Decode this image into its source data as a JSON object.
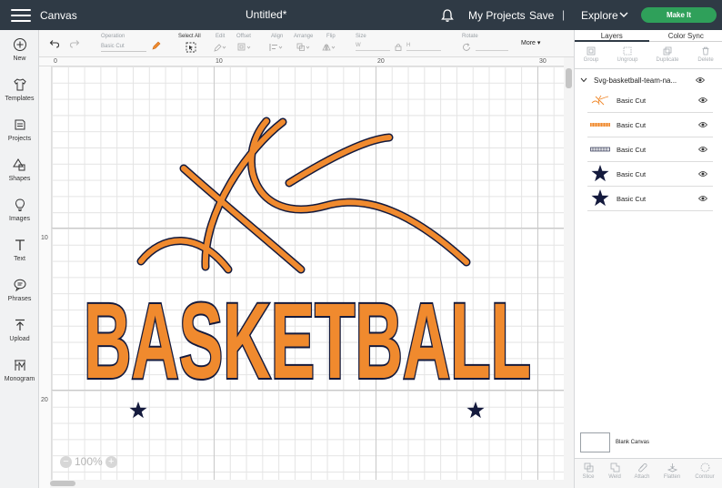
{
  "topbar": {
    "app_title": "Canvas",
    "doc_title": "Untitled*",
    "my_projects": "My Projects",
    "save": "Save",
    "separator": "|",
    "explore": "Explore",
    "make_it": "Make It",
    "make_it_color": "#2fa05a"
  },
  "sidebar": {
    "items": [
      {
        "label": "New",
        "icon": "plus-icon"
      },
      {
        "label": "Templates",
        "icon": "shirt-icon"
      },
      {
        "label": "Projects",
        "icon": "folder-icon"
      },
      {
        "label": "Shapes",
        "icon": "shapes-icon"
      },
      {
        "label": "Images",
        "icon": "lightbulb-icon"
      },
      {
        "label": "Text",
        "icon": "text-icon"
      },
      {
        "label": "Phrases",
        "icon": "chat-bubble-icon"
      },
      {
        "label": "Upload",
        "icon": "upload-icon"
      },
      {
        "label": "Monogram",
        "icon": "monogram-icon"
      }
    ]
  },
  "toolbar": {
    "operation_label": "Operation",
    "operation_value": "Basic Cut",
    "select_all": "Select All",
    "edit": "Edit",
    "offset": "Offset",
    "align": "Align",
    "arrange": "Arrange",
    "flip": "Flip",
    "size": "Size",
    "size_w": "W",
    "size_h": "H",
    "rotate": "Rotate",
    "more": "More"
  },
  "rulers": {
    "top": [
      "0",
      "10",
      "20",
      "30"
    ],
    "left": [
      "10",
      "20"
    ]
  },
  "canvas": {
    "zoom": "100%",
    "design_text": "BASKETBALL",
    "orange": "#f08a2e",
    "navy": "#141a3d"
  },
  "panel": {
    "tab_layers": "Layers",
    "tab_color_sync": "Color Sync",
    "actions": [
      "Group",
      "Ungroup",
      "Duplicate",
      "Delete"
    ],
    "group_name": "Svg-basketball-team-na...",
    "layers": [
      {
        "name": "Basic Cut",
        "thumb": "ball-lines-thumb"
      },
      {
        "name": "Basic Cut",
        "thumb": "orange-text-thumb"
      },
      {
        "name": "Basic Cut",
        "thumb": "outline-text-thumb"
      },
      {
        "name": "Basic Cut",
        "thumb": "star-thumb"
      },
      {
        "name": "Basic Cut",
        "thumb": "star-thumb"
      }
    ],
    "blank_canvas": "Blank Canvas",
    "bottom_actions": [
      "Slice",
      "Weld",
      "Attach",
      "Flatten",
      "Contour"
    ]
  }
}
